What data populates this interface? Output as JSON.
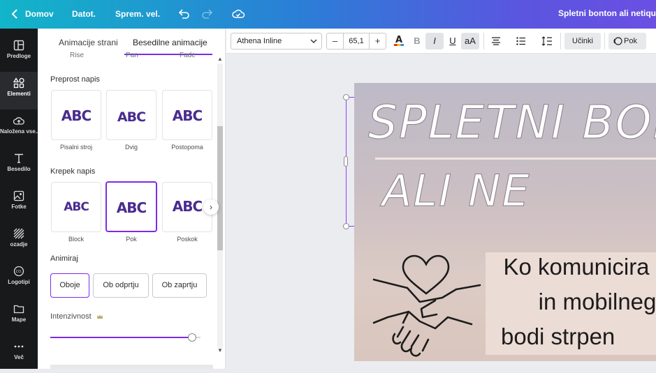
{
  "topbar": {
    "home": "Domov",
    "file": "Datot.",
    "resize": "Sprem. vel.",
    "doc_title": "Spletni bonton ali netiquette"
  },
  "leftnav": {
    "items": [
      {
        "label": "Predloge",
        "icon": "template-icon"
      },
      {
        "label": "Elementi",
        "icon": "elements-icon"
      },
      {
        "label": "Naložena vse...",
        "icon": "upload-icon"
      },
      {
        "label": "Besedilo",
        "icon": "text-icon"
      },
      {
        "label": "Fotke",
        "icon": "photo-icon"
      },
      {
        "label": "ozadje",
        "icon": "background-icon"
      },
      {
        "label": "Logotipi",
        "icon": "logo-icon"
      },
      {
        "label": "Mape",
        "icon": "folder-icon"
      },
      {
        "label": "Več",
        "icon": "more-icon"
      }
    ]
  },
  "panel": {
    "tab_page": "Animacije strani",
    "tab_text": "Besedilne animacije",
    "prev_labels": [
      "Rise",
      "Pan",
      "Fade"
    ],
    "section_simple": "Preprost napis",
    "simple_tiles": [
      {
        "label": "Pisalni stroj",
        "preview": "ABC"
      },
      {
        "label": "Dvig",
        "preview": "ABC"
      },
      {
        "label": "Postopoma",
        "preview": "ABC"
      }
    ],
    "section_bold": "Krepek napis",
    "bold_tiles": [
      {
        "label": "Block",
        "preview": "ABC"
      },
      {
        "label": "Pok",
        "preview": "ABC"
      },
      {
        "label": "Poskok",
        "preview": "ABC"
      }
    ],
    "selected_tile": "Pok",
    "animate_label": "Animiraj",
    "animate_options": [
      "Oboje",
      "Ob odprtju",
      "Ob zaprtju"
    ],
    "animate_selected": "Oboje",
    "intensity_label": "Intenzivnost",
    "intensity_value": 0.95
  },
  "toolbar": {
    "font": "Athena Inline",
    "font_size": "65,1",
    "minus": "–",
    "plus": "+",
    "bold": "B",
    "italic": "I",
    "underline": "U",
    "case": "aA",
    "effects": "Učinki",
    "animate": "Pok"
  },
  "slide": {
    "title_line1": "SPLETNI BONTON",
    "title_line2": "ALI NE",
    "body_lines": [
      "Ko komunicira",
      "in mobilneg",
      "bodi strpen"
    ]
  },
  "colors": {
    "accent": "#7d2ae8",
    "nav_bg": "#18191b",
    "preview_purple": "#4a2c8f"
  }
}
